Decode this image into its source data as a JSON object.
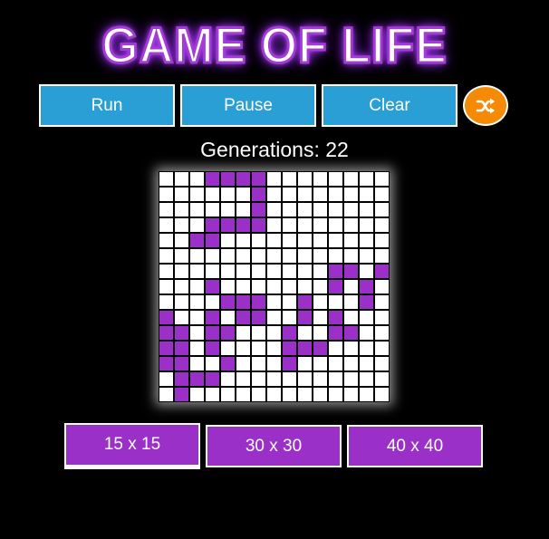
{
  "title": "GAME OF LIFE",
  "controls": {
    "run": "Run",
    "pause": "Pause",
    "clear": "Clear",
    "shuffle_icon": "shuffle-icon"
  },
  "generations_text": "Generations: 22",
  "grid": {
    "size": 15,
    "rows": [
      "...####........",
      "......#........",
      "......#........",
      "...####........",
      "..##...........",
      "...............",
      "...........##.#",
      "...#.......#.#.",
      "....###..#...#.",
      "#..#.##..#.#...",
      "##.##...#..##..",
      "##.#....###....",
      "##..#...#......",
      ".###...........",
      ".#............."
    ]
  },
  "sizes": [
    {
      "label": "15 x 15",
      "selected": true
    },
    {
      "label": "30 x 30",
      "selected": false
    },
    {
      "label": "40 x 40",
      "selected": false
    }
  ],
  "colors": {
    "accent": "#9a30c8",
    "button": "#2a9fd6",
    "shuffle": "#f58a07"
  }
}
